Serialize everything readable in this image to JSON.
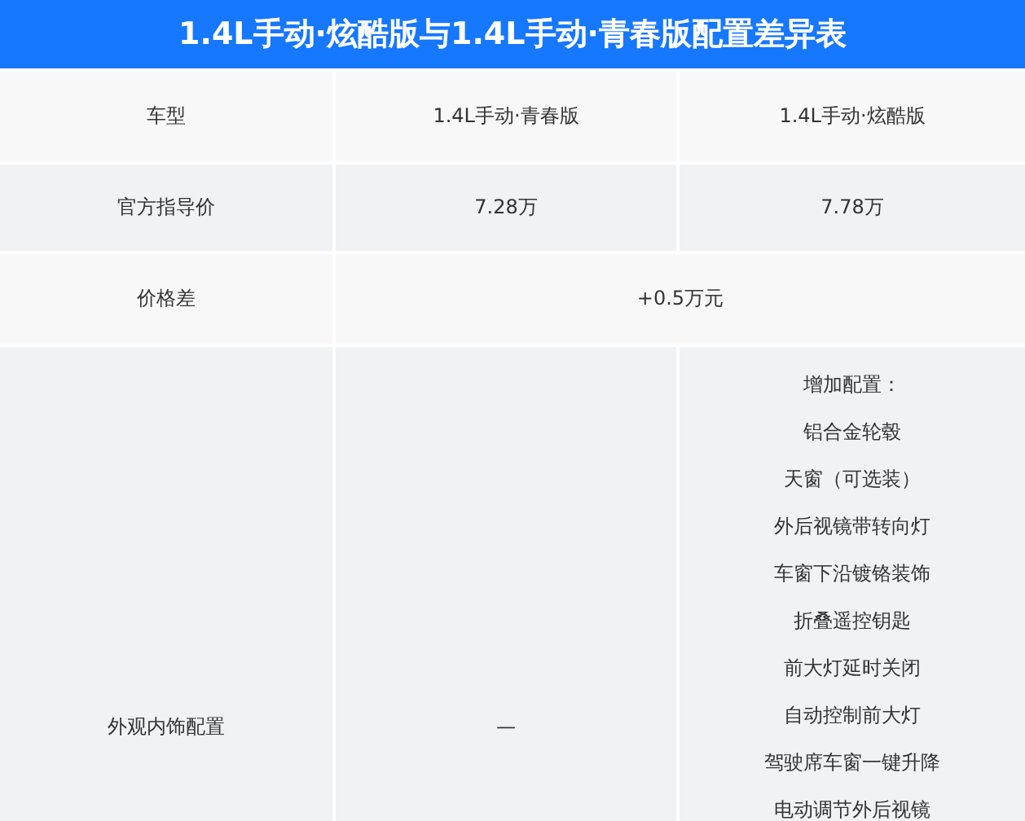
{
  "title": "1.4L手动·炫酷版与1.4L手动·青春版配置差异表",
  "rows": [
    {
      "kind": "pair",
      "label": "车型",
      "values": [
        "1.4L手动·青春版",
        "1.4L手动·炫酷版"
      ]
    },
    {
      "kind": "pair",
      "label": "官方指导价",
      "values": [
        "7.28万",
        "7.78万"
      ]
    },
    {
      "kind": "span",
      "label": "价格差",
      "value": "+0.5万元"
    },
    {
      "kind": "list",
      "label": "外观内饰配置",
      "left": "—",
      "heading": "增加配置：",
      "items": [
        "铝合金轮毂",
        "天窗（可选装）",
        "外后视镜带转向灯",
        "车窗下沿镀铬装饰",
        "折叠遥控钥匙",
        "前大灯延时关闭",
        "自动控制前大灯",
        "驾驶席车窗一键升降",
        "电动调节外后视镜"
      ]
    }
  ]
}
